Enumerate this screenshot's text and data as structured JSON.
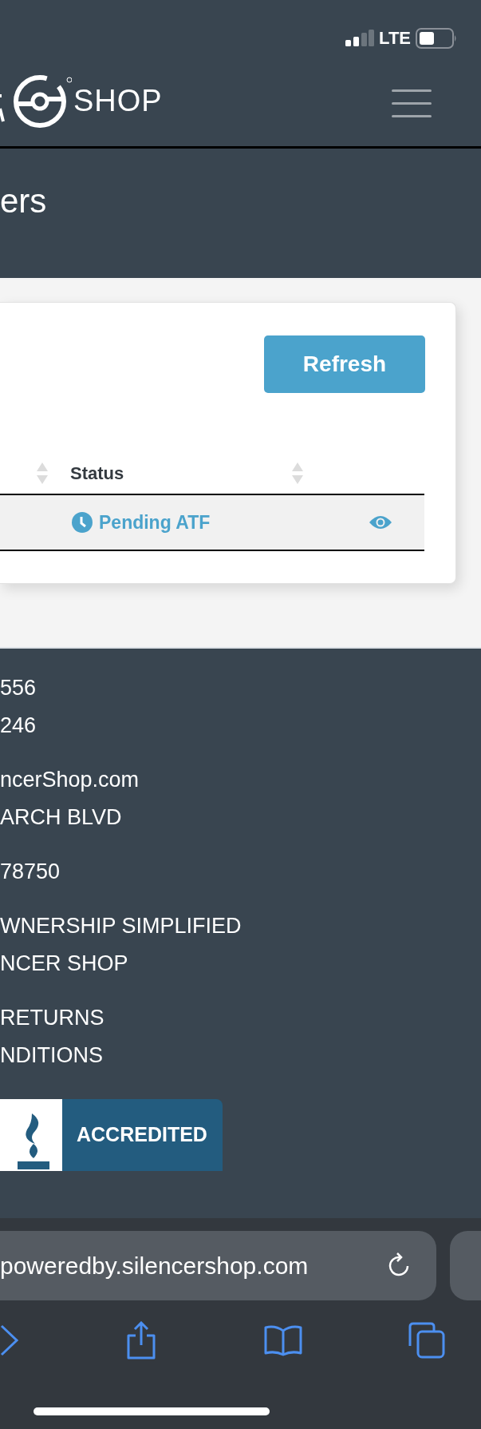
{
  "status_bar": {
    "network": "LTE"
  },
  "header": {
    "logo_text": "SHOP"
  },
  "page_title": "ers",
  "card": {
    "refresh_button": "Refresh",
    "table": {
      "columns": [
        {
          "label": "Status"
        }
      ],
      "rows": [
        {
          "status": "Pending ATF"
        }
      ]
    }
  },
  "footer": {
    "groups": [
      [
        "556",
        "246"
      ],
      [
        "ncerShop.com",
        "ARCH BLVD"
      ],
      [
        "78750"
      ],
      [
        "WNERSHIP SIMPLIFIED",
        "NCER SHOP"
      ],
      [
        "RETURNS",
        "NDITIONS"
      ]
    ],
    "badge_text": "ACCREDITED"
  },
  "browser": {
    "url": "poweredby.silencershop.com"
  }
}
